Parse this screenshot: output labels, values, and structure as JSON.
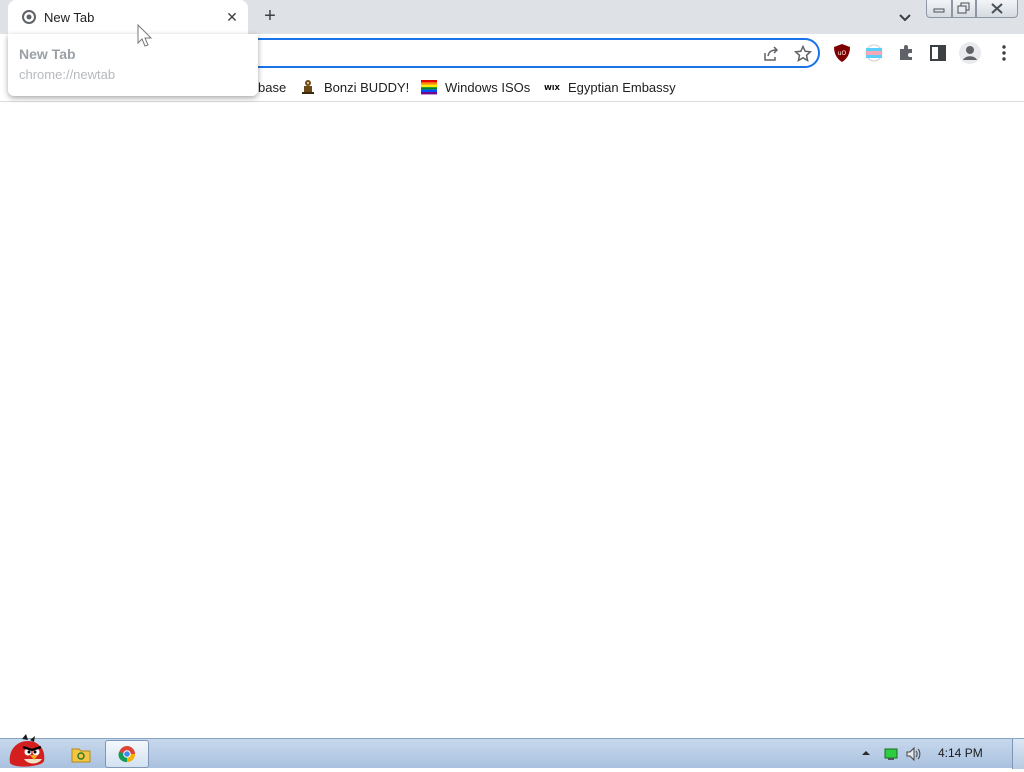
{
  "tabs": [
    {
      "title": "New Tab",
      "favicon": "chrome-newtab-icon"
    }
  ],
  "hover_card": {
    "title": "New Tab",
    "url": "chrome://newtab"
  },
  "omnibox": {
    "value": "",
    "placeholder": ""
  },
  "bookmarks": [
    {
      "label": "base",
      "icon": "bookmark-favicon"
    },
    {
      "label": "Bonzi BUDDY!",
      "icon": "bonzi-icon"
    },
    {
      "label": "Windows ISOs",
      "icon": "rainbow-flag-icon"
    },
    {
      "label": "Egyptian Embassy",
      "icon": "wix-icon"
    }
  ],
  "toolbar_icons": [
    "share-icon",
    "bookmark-star-icon",
    "ublock-icon",
    "flag-extension-icon",
    "puzzle-icon",
    "side-panel-icon",
    "profile-icon",
    "menu-icon"
  ],
  "taskbar": {
    "clock": "4:14 PM",
    "apps": [
      "file-explorer-icon",
      "chrome-icon"
    ]
  },
  "colors": {
    "accent": "#1a73e8",
    "tabstrip": "#dee1e6",
    "taskbar": "#b9cde6"
  }
}
